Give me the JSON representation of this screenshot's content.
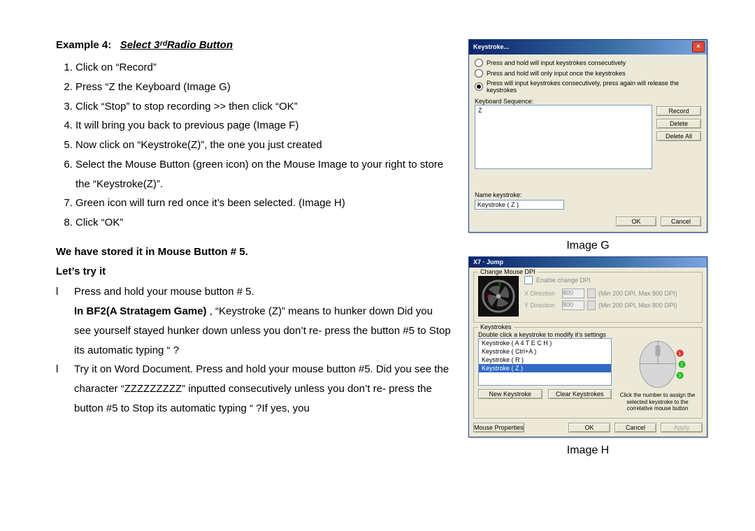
{
  "heading_prefix": "Example 4:",
  "heading_title": "Select 3ʳᵈRadio Button",
  "steps": [
    "Click on “Record”",
    "Press “Z the Keyboard (Image G)",
    "Click “Stop” to stop recording >> then click “OK”",
    "It will bring you back to previous page (Image F)",
    "Now click on “Keystroke(Z)”, the one you just created",
    "Select the Mouse Button (green icon) on the Mouse Image to your right to store the “Keystroke(Z)”.",
    "Green icon will turn red once it’s been selected. (Image H)",
    "Click “OK”"
  ],
  "stored_line": "We have stored it in Mouse Button # 5.",
  "lets_try": "Let’s try it",
  "bullets": {
    "mark": "l",
    "b1": "Press and hold your mouse button # 5.",
    "b2_bold": "In BF2(A Stratagem Game) ",
    "b2_rest": ", “Keystroke (Z)” means to hunker down Did you see yourself stayed hunker down unless you don’t re- press the button #5 to Stop its automatic typing “ ?",
    "b3": "Try it on Word Document.   Press and hold your mouse button #5.   Did you see the character “ZZZZZZZZZ” inputted consecutively unless you don’t re- press the button #5 to Stop its automatic typing “ ?If yes, you"
  },
  "captions": {
    "g": "Image G",
    "h": "Image H"
  },
  "dlgG": {
    "title": "Keystroke...",
    "radios": [
      "Press and hold will input keystrokes consecutively",
      "Press and hold will only input once the keystrokes",
      "Press will input keystrokes consecutively, press again will release the keystrokes"
    ],
    "selected_radio": 2,
    "seq_label": "Keyboard Sequence:",
    "seq_value": "Z",
    "btn_record": "Record",
    "btn_delete": "Delete",
    "btn_delete_all": "Delete All",
    "name_label": "Name keystroke:",
    "name_value": "Keystroke ( Z )",
    "ok": "OK",
    "cancel": "Cancel"
  },
  "dlgH": {
    "title": "X7 · Jump",
    "grp_dpi": "Change Mouse DPI",
    "enable_dpi": "Enable change DPI",
    "xdir": "X Direction",
    "ydir": "Y Direction",
    "dpi_val": "800",
    "dpi_hint": "(Min 200 DPI, Max 800 DPI)",
    "grp_keys": "Keystrokes",
    "klist_hint": "Double click a keystroke to modify it’s settings",
    "klist": [
      "Keystroke ( A 4 T E C H )",
      "Keystroke ( Ctrl+A )",
      "Keystroke ( R )",
      "Keystroke ( Z )"
    ],
    "klist_selected": 3,
    "new_k": "New Keystroke",
    "clear_k": "Clear Keystrokes",
    "mouse_hint": "Click the number to assign the selected keystroke to the correlative mouse button",
    "mouse_props": "Mouse Properties",
    "ok": "OK",
    "cancel": "Cancel",
    "apply": "Apply"
  }
}
